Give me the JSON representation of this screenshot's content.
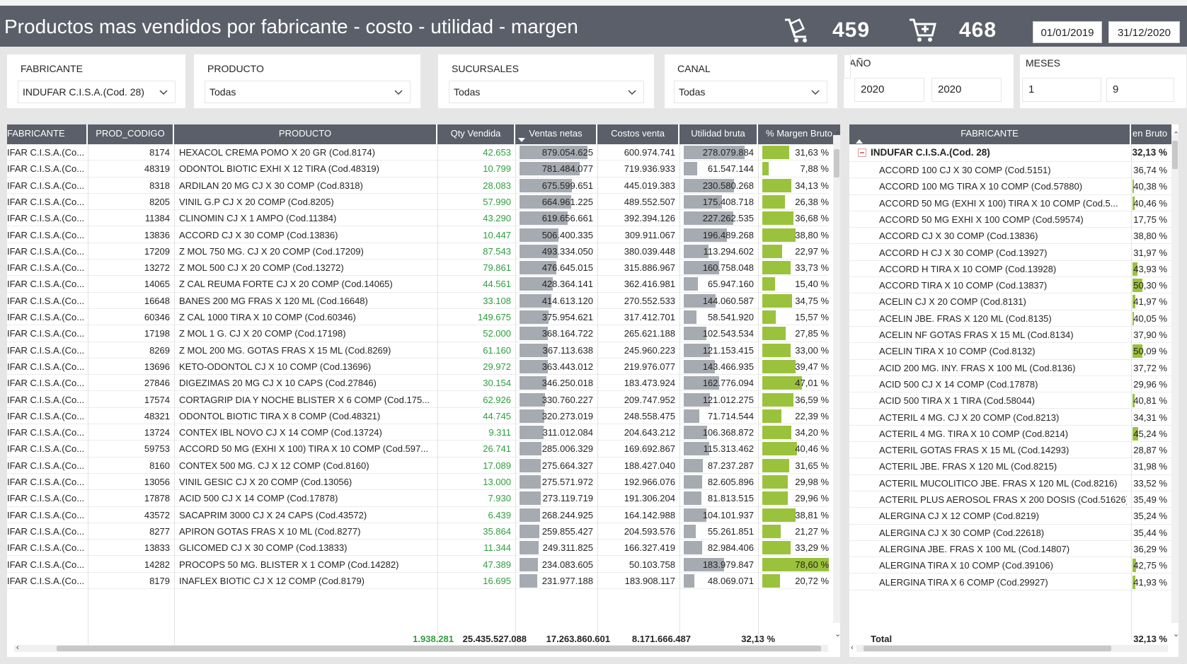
{
  "header": {
    "title": "Productos mas vendidos por fabricante - costo - utilidad - margen",
    "kpi1_value": "459",
    "kpi2_value": "468",
    "date_from": "01/01/2019",
    "date_to": "31/12/2020",
    "kpi1_icon": "box-cart-icon",
    "kpi2_icon": "cart-add-icon"
  },
  "filters": {
    "fabricante": {
      "label": "FABRICANTE",
      "value": "INDUFAR C.I.S.A.(Cod. 28)"
    },
    "producto": {
      "label": "PRODUCTO",
      "value": "Todas"
    },
    "sucursales": {
      "label": "SUCURSALES",
      "value": "Todas"
    },
    "canal": {
      "label": "CANAL",
      "value": "Todas"
    },
    "anio": {
      "label": "AÑO",
      "from": "2020",
      "to": "2020"
    },
    "meses": {
      "label": "MESES",
      "from": "1",
      "to": "9"
    }
  },
  "main_table": {
    "columns": [
      "FABRICANTE",
      "PROD_CODIGO",
      "PRODUCTO",
      "Qty Vendida",
      "Ventas netas",
      "Costos venta",
      "Utilidad bruta",
      "% Margen Bruto"
    ],
    "rows": [
      {
        "fab": "IFAR C.I.S.A.(Co...",
        "code": "8174",
        "prod": "HEXACOL CREMA POMO X 20 GR (Cod.8174)",
        "qty": "42.653",
        "ventas": "879.054.625",
        "costos": "600.974.741",
        "util": "278.079.884",
        "margen": "31,63 %",
        "v": 879054625,
        "u": 278079884,
        "m": 31.63
      },
      {
        "fab": "IFAR C.I.S.A.(Co...",
        "code": "48319",
        "prod": "ODONTOL BIOTIC EXHI X 12 TIRA (Cod.48319)",
        "qty": "10.799",
        "ventas": "781.484.077",
        "costos": "719.936.933",
        "util": "61.547.144",
        "margen": "7,88 %",
        "v": 781484077,
        "u": 61547144,
        "m": 7.88
      },
      {
        "fab": "IFAR C.I.S.A.(Co...",
        "code": "8318",
        "prod": "ARDILAN 20 MG CJ X 30 COMP (Cod.8318)",
        "qty": "28.083",
        "ventas": "675.599.651",
        "costos": "445.019.383",
        "util": "230.580.268",
        "margen": "34,13 %",
        "v": 675599651,
        "u": 230580268,
        "m": 34.13
      },
      {
        "fab": "IFAR C.I.S.A.(Co...",
        "code": "8205",
        "prod": "VINIL G.P CJ X 20 COMP (Cod.8205)",
        "qty": "57.990",
        "ventas": "664.961.225",
        "costos": "489.552.507",
        "util": "175.408.718",
        "margen": "26,38 %",
        "v": 664961225,
        "u": 175408718,
        "m": 26.38
      },
      {
        "fab": "IFAR C.I.S.A.(Co...",
        "code": "11384",
        "prod": "CLINOMIN CJ X 1 AMPO (Cod.11384)",
        "qty": "43.290",
        "ventas": "619.656.661",
        "costos": "392.394.126",
        "util": "227.262.535",
        "margen": "36,68 %",
        "v": 619656661,
        "u": 227262535,
        "m": 36.68
      },
      {
        "fab": "IFAR C.I.S.A.(Co...",
        "code": "13836",
        "prod": "ACCORD CJ X 30 COMP (Cod.13836)",
        "qty": "10.447",
        "ventas": "506.400.335",
        "costos": "309.911.067",
        "util": "196.489.268",
        "margen": "38,80 %",
        "v": 506400335,
        "u": 196489268,
        "m": 38.8
      },
      {
        "fab": "IFAR C.I.S.A.(Co...",
        "code": "17209",
        "prod": "Z MOL 750 MG. CJ X 20 COMP (Cod.17209)",
        "qty": "87.543",
        "ventas": "493.334.050",
        "costos": "380.039.448",
        "util": "113.294.602",
        "margen": "22,97 %",
        "v": 493334050,
        "u": 113294602,
        "m": 22.97
      },
      {
        "fab": "IFAR C.I.S.A.(Co...",
        "code": "13272",
        "prod": "Z MOL 500 CJ X 20 COMP (Cod.13272)",
        "qty": "79.861",
        "ventas": "476.645.015",
        "costos": "315.886.967",
        "util": "160.758.048",
        "margen": "33,73 %",
        "v": 476645015,
        "u": 160758048,
        "m": 33.73
      },
      {
        "fab": "IFAR C.I.S.A.(Co...",
        "code": "14065",
        "prod": "Z CAL REUMA FORTE CJ X 20 COMP (Cod.14065)",
        "qty": "44.561",
        "ventas": "428.364.141",
        "costos": "362.416.981",
        "util": "65.947.160",
        "margen": "15,40 %",
        "v": 428364141,
        "u": 65947160,
        "m": 15.4
      },
      {
        "fab": "IFAR C.I.S.A.(Co...",
        "code": "16648",
        "prod": "BANES 200 MG FRAS X 120 ML (Cod.16648)",
        "qty": "33.108",
        "ventas": "414.613.120",
        "costos": "270.552.533",
        "util": "144.060.587",
        "margen": "34,75 %",
        "v": 414613120,
        "u": 144060587,
        "m": 34.75
      },
      {
        "fab": "IFAR C.I.S.A.(Co...",
        "code": "60346",
        "prod": "Z CAL 1000 TIRA X 10 COMP (Cod.60346)",
        "qty": "149.675",
        "ventas": "375.954.621",
        "costos": "317.412.701",
        "util": "58.541.920",
        "margen": "15,57 %",
        "v": 375954621,
        "u": 58541920,
        "m": 15.57
      },
      {
        "fab": "IFAR C.I.S.A.(Co...",
        "code": "17198",
        "prod": "Z MOL 1 G. CJ X 20 COMP (Cod.17198)",
        "qty": "52.000",
        "ventas": "368.164.722",
        "costos": "265.621.188",
        "util": "102.543.534",
        "margen": "27,85 %",
        "v": 368164722,
        "u": 102543534,
        "m": 27.85
      },
      {
        "fab": "IFAR C.I.S.A.(Co...",
        "code": "8269",
        "prod": "Z MOL 200 MG. GOTAS FRAS X 15 ML (Cod.8269)",
        "qty": "61.160",
        "ventas": "367.113.638",
        "costos": "245.960.223",
        "util": "121.153.415",
        "margen": "33,00 %",
        "v": 367113638,
        "u": 121153415,
        "m": 33.0
      },
      {
        "fab": "IFAR C.I.S.A.(Co...",
        "code": "13696",
        "prod": "KETO-ODONTOL CJ X 10 COMP (Cod.13696)",
        "qty": "29.972",
        "ventas": "363.443.012",
        "costos": "219.976.077",
        "util": "143.466.935",
        "margen": "39,47 %",
        "v": 363443012,
        "u": 143466935,
        "m": 39.47
      },
      {
        "fab": "IFAR C.I.S.A.(Co...",
        "code": "27846",
        "prod": "DIGEZIMAS 20 MG CJ X 10 CAPS (Cod.27846)",
        "qty": "30.154",
        "ventas": "346.250.018",
        "costos": "183.473.924",
        "util": "162.776.094",
        "margen": "47,01 %",
        "v": 346250018,
        "u": 162776094,
        "m": 47.01
      },
      {
        "fab": "IFAR C.I.S.A.(Co...",
        "code": "17574",
        "prod": "CORTAGRIP DIA Y NOCHE BLISTER X 6 COMP (Cod.175...",
        "qty": "62.926",
        "ventas": "330.760.227",
        "costos": "209.747.952",
        "util": "121.012.275",
        "margen": "36,59 %",
        "v": 330760227,
        "u": 121012275,
        "m": 36.59
      },
      {
        "fab": "IFAR C.I.S.A.(Co...",
        "code": "48321",
        "prod": "ODONTOL BIOTIC TIRA X 8 COMP (Cod.48321)",
        "qty": "44.745",
        "ventas": "320.273.019",
        "costos": "248.558.475",
        "util": "71.714.544",
        "margen": "22,39 %",
        "v": 320273019,
        "u": 71714544,
        "m": 22.39
      },
      {
        "fab": "IFAR C.I.S.A.(Co...",
        "code": "13724",
        "prod": "CONTEX IBL NOVO CJ X 14 COMP (Cod.13724)",
        "qty": "9.311",
        "ventas": "311.012.084",
        "costos": "204.643.212",
        "util": "106.368.872",
        "margen": "34,20 %",
        "v": 311012084,
        "u": 106368872,
        "m": 34.2
      },
      {
        "fab": "IFAR C.I.S.A.(Co...",
        "code": "59753",
        "prod": "ACCORD 50 MG (EXHI X 100) TIRA X 10 COMP (Cod.597...",
        "qty": "26.741",
        "ventas": "285.006.329",
        "costos": "169.692.867",
        "util": "115.313.462",
        "margen": "40,46 %",
        "v": 285006329,
        "u": 115313462,
        "m": 40.46
      },
      {
        "fab": "IFAR C.I.S.A.(Co...",
        "code": "8160",
        "prod": "CONTEX 500 MG. CJ X 12 COMP (Cod.8160)",
        "qty": "17.089",
        "ventas": "275.664.327",
        "costos": "188.427.040",
        "util": "87.237.287",
        "margen": "31,65 %",
        "v": 275664327,
        "u": 87237287,
        "m": 31.65
      },
      {
        "fab": "IFAR C.I.S.A.(Co...",
        "code": "13056",
        "prod": "VINIL GESIC CJ X 20 COMP (Cod.13056)",
        "qty": "13.000",
        "ventas": "275.571.972",
        "costos": "192.966.076",
        "util": "82.605.896",
        "margen": "29,98 %",
        "v": 275571972,
        "u": 82605896,
        "m": 29.98
      },
      {
        "fab": "IFAR C.I.S.A.(Co...",
        "code": "17878",
        "prod": "ACID 500 CJ X 14 COMP (Cod.17878)",
        "qty": "7.930",
        "ventas": "273.119.719",
        "costos": "191.306.204",
        "util": "81.813.515",
        "margen": "29,96 %",
        "v": 273119719,
        "u": 81813515,
        "m": 29.96
      },
      {
        "fab": "IFAR C.I.S.A.(Co...",
        "code": "43572",
        "prod": "SACAPRIM 3000 CJ X 24 CAPS (Cod.43572)",
        "qty": "6.439",
        "ventas": "268.244.925",
        "costos": "164.142.988",
        "util": "104.101.937",
        "margen": "38,81 %",
        "v": 268244925,
        "u": 104101937,
        "m": 38.81
      },
      {
        "fab": "IFAR C.I.S.A.(Co...",
        "code": "8277",
        "prod": "APIRON GOTAS FRAS X 10 ML (Cod.8277)",
        "qty": "35.864",
        "ventas": "259.855.427",
        "costos": "204.593.576",
        "util": "55.261.851",
        "margen": "21,27 %",
        "v": 259855427,
        "u": 55261851,
        "m": 21.27
      },
      {
        "fab": "IFAR C.I.S.A.(Co...",
        "code": "13833",
        "prod": "GLICOMED CJ X 30 COMP (Cod.13833)",
        "qty": "11.344",
        "ventas": "249.311.825",
        "costos": "166.327.419",
        "util": "82.984.406",
        "margen": "33,29 %",
        "v": 249311825,
        "u": 82984406,
        "m": 33.29
      },
      {
        "fab": "IFAR C.I.S.A.(Co...",
        "code": "14282",
        "prod": "PROCOPS 50 MG. BLISTER X 1 COMP (Cod.14282)",
        "qty": "47.389",
        "ventas": "234.083.605",
        "costos": "50.103.758",
        "util": "183.979.847",
        "margen": "78,60 %",
        "v": 234083605,
        "u": 183979847,
        "m": 78.6
      },
      {
        "fab": "IFAR C.I.S.A.(Co...",
        "code": "8179",
        "prod": "INAFLEX BIOTIC CJ X 12 COMP (Cod.8179)",
        "qty": "16.695",
        "ventas": "231.977.188",
        "costos": "183.908.117",
        "util": "48.069.071",
        "margen": "20,72 %",
        "v": 231977188,
        "u": 48069071,
        "m": 20.72
      }
    ],
    "totals": {
      "qty": "1.938.281",
      "ventas": "25.435.527.088",
      "costos": "17.263.860.601",
      "util": "8.171.666.487",
      "margen": "32,13 %"
    }
  },
  "side_table": {
    "columns": [
      "FABRICANTE",
      "en Bruto"
    ],
    "group": {
      "label": "INDUFAR C.I.S.A.(Cod. 28)",
      "value": "32,13 %",
      "expand_icon": "collapse-minus-icon"
    },
    "rows": [
      {
        "label": "ACCORD 100 CJ X 30 COMP (Cod.5151)",
        "value": "36,74 %",
        "m": 36.74
      },
      {
        "label": "ACCORD 100 MG TIRA X 10 COMP (Cod.57880)",
        "value": "40,38 %",
        "m": 40.38
      },
      {
        "label": "ACCORD 50 MG (EXHI X 100) TIRA X 10 COMP (Cod.5...",
        "value": "40,46 %",
        "m": 40.46
      },
      {
        "label": "ACCORD 50 MG EXHI X 100 COMP (Cod.59574)",
        "value": "17,75 %",
        "m": 17.75
      },
      {
        "label": "ACCORD CJ X 30 COMP (Cod.13836)",
        "value": "38,80 %",
        "m": 38.8
      },
      {
        "label": "ACCORD H CJ X 30 COMP (Cod.13927)",
        "value": "31,97 %",
        "m": 31.97
      },
      {
        "label": "ACCORD H TIRA X 10 COMP (Cod.13928)",
        "value": "43,93 %",
        "m": 43.93
      },
      {
        "label": "ACCORD TIRA X 10 COMP (Cod.13837)",
        "value": "50,30 %",
        "m": 50.3
      },
      {
        "label": "ACELIN CJ X 20 COMP (Cod.8131)",
        "value": "41,97 %",
        "m": 41.97
      },
      {
        "label": "ACELIN JBE. FRAS X 120 ML (Cod.8135)",
        "value": "40,05 %",
        "m": 40.05
      },
      {
        "label": "ACELIN NF GOTAS FRAS X 15 ML (Cod.8134)",
        "value": "37,90 %",
        "m": 37.9
      },
      {
        "label": "ACELIN TIRA X 10 COMP (Cod.8132)",
        "value": "50,09 %",
        "m": 50.09
      },
      {
        "label": "ACID 200 MG. INY. FRAS X 100 ML (Cod.8136)",
        "value": "37,72 %",
        "m": 37.72
      },
      {
        "label": "ACID 500 CJ X 14 COMP (Cod.17878)",
        "value": "29,96 %",
        "m": 29.96
      },
      {
        "label": "ACID 500 TIRA X 1 TIRA (Cod.58044)",
        "value": "40,81 %",
        "m": 40.81
      },
      {
        "label": "ACTERIL 4 MG. CJ X 20 COMP (Cod.8213)",
        "value": "34,31 %",
        "m": 34.31
      },
      {
        "label": "ACTERIL 4 MG. TIRA X 10 COMP (Cod.8214)",
        "value": "45,24 %",
        "m": 45.24
      },
      {
        "label": "ACTERIL GOTAS FRAS X 15 ML (Cod.14293)",
        "value": "28,87 %",
        "m": 28.87
      },
      {
        "label": "ACTERIL JBE. FRAS X 120 ML (Cod.8215)",
        "value": "31,98 %",
        "m": 31.98
      },
      {
        "label": "ACTERIL MUCOLITICO JBE. FRAS X 120 ML (Cod.8216)",
        "value": "33,52 %",
        "m": 33.52
      },
      {
        "label": "ACTERIL PLUS AEROSOL FRAS X 200 DOSIS (Cod.51626)",
        "value": "35,49 %",
        "m": 35.49
      },
      {
        "label": "ALERGINA CJ X 12 COMP (Cod.8219)",
        "value": "35,24 %",
        "m": 35.24
      },
      {
        "label": "ALERGINA CJ X 30 COMP (Cod.22618)",
        "value": "35,44 %",
        "m": 35.44
      },
      {
        "label": "ALERGINA JBE. FRAS X 100 ML (Cod.14807)",
        "value": "36,29 %",
        "m": 36.29
      },
      {
        "label": "ALERGINA TIRA X 10 COMP (Cod.39106)",
        "value": "42,75 %",
        "m": 42.75
      },
      {
        "label": "ALERGINA TIRA X 6 COMP (Cod.29927)",
        "value": "41,93 %",
        "m": 41.93
      }
    ],
    "total_label": "Total",
    "total_value": "32,13 %"
  },
  "colors": {
    "header_bg": "#5b5f6a",
    "qty_green": "#2e9e3e",
    "bar_gray": "#a6aab1",
    "bar_lime": "#9bc23c"
  }
}
